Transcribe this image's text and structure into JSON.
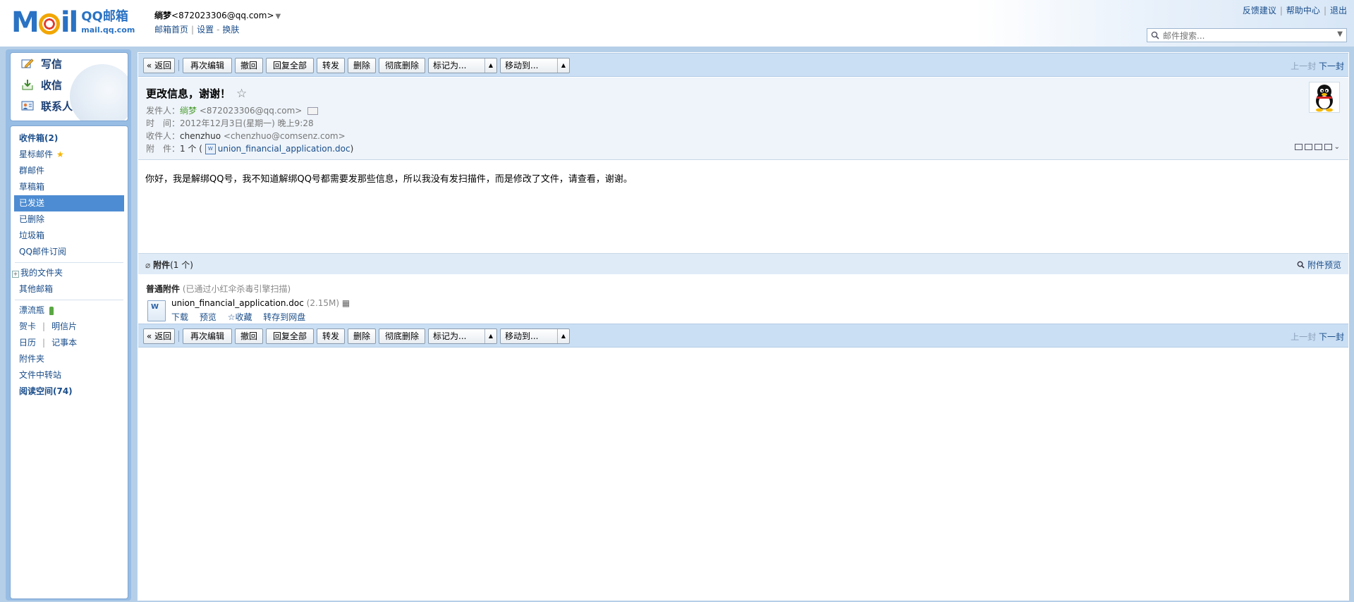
{
  "header": {
    "logo": {
      "moil_pre": "M",
      "moil_post": "il",
      "cn": "QQ邮箱",
      "url": "mail.qq.com"
    },
    "user_name": "绱梦",
    "user_email": "<872023306@qq.com>",
    "nav": [
      "邮箱首页",
      "设置",
      "换肤"
    ],
    "nav_seps": [
      "|",
      "-"
    ],
    "top_links": [
      "反馈建议",
      "帮助中心",
      "退出"
    ],
    "search_placeholder": "邮件搜索..."
  },
  "quick": {
    "compose": "写信",
    "inbox": "收信",
    "contacts": "联系人"
  },
  "folders": {
    "inbox": "收件箱(2)",
    "starred": "星标邮件",
    "group": "群邮件",
    "drafts": "草稿箱",
    "sent": "已发送",
    "deleted": "已删除",
    "spam": "垃圾箱",
    "subscription": "QQ邮件订阅",
    "my_folders": "我的文件夹",
    "other": "其他邮箱",
    "bottle": "漂流瓶",
    "card": "贺卡",
    "postcard": "明信片",
    "calendar": "日历",
    "notebook": "记事本",
    "attach_folder": "附件夹",
    "transfer": "文件中转站",
    "reading": "阅读空间(74)",
    "vsep": "|"
  },
  "toolbar": {
    "back": "« 返回",
    "reedit": "再次编辑",
    "recall": "撤回",
    "reply_all": "回复全部",
    "forward": "转发",
    "delete": "删除",
    "perm_delete": "彻底删除",
    "mark_as": "标记为...",
    "move_to": "移动到...",
    "prev": "上一封",
    "next": "下一封"
  },
  "mail": {
    "subject": "更改信息，谢谢！",
    "from_label": "发件人：",
    "from_name": "绱梦",
    "from_email": "<872023306@qq.com>",
    "time_label": "时　间：",
    "time_value": "2012年12月3日(星期一) 晚上9:28",
    "to_label": "收件人：",
    "to_name": "chenzhuo",
    "to_email": "<chenzhuo@comsenz.com>",
    "attach_label": "附　件：",
    "attach_count": "1 个 (",
    "attach_name": "union_financial_application.doc",
    "attach_close": ")",
    "body": "你好，我是解绑QQ号，我不知道解绑QQ号都需要发那些信息，所以我没有发扫描件，而是修改了文件，请查看，谢谢。"
  },
  "attachments": {
    "title": "附件",
    "count": "(1 个)",
    "preview": "附件预览",
    "normal": "普通附件",
    "scan": "(已通过小红伞杀毒引擎扫描)",
    "file_name": "union_financial_application.doc",
    "file_size": "(2.15M)",
    "actions": [
      "下载",
      "预览",
      "☆收藏",
      "转存到网盘"
    ]
  },
  "colors": {
    "accent": "#4d8cd2",
    "frame": "#b6cfe8",
    "toolbar": "#cadff4"
  }
}
